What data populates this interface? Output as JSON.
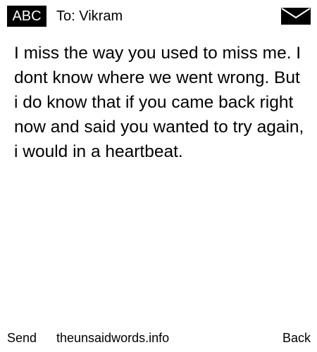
{
  "header": {
    "mode_label": "ABC",
    "recipient": "To: Vikram",
    "icon": "envelope-icon"
  },
  "message": {
    "body": "I miss the way you used to miss me. I dont know where we went wrong. But i do know that if you came back right now and said you wanted to try again, i would in a heartbeat."
  },
  "footer": {
    "send_label": "Send",
    "site_label": "theunsaidwords.info",
    "back_label": "Back"
  },
  "colors": {
    "background": "#ffffff",
    "text": "#000000",
    "badge_background": "#000000",
    "badge_text": "#ffffff"
  }
}
